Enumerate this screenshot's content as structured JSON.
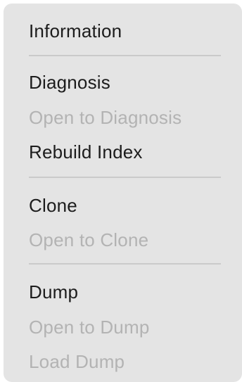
{
  "menu": {
    "items": [
      {
        "label": "Information",
        "enabled": true
      },
      {
        "label": "Diagnosis",
        "enabled": true
      },
      {
        "label": "Open to Diagnosis",
        "enabled": false
      },
      {
        "label": "Rebuild Index",
        "enabled": true
      },
      {
        "label": "Clone",
        "enabled": true
      },
      {
        "label": "Open to Clone",
        "enabled": false
      },
      {
        "label": "Dump",
        "enabled": true
      },
      {
        "label": "Open to Dump",
        "enabled": false
      },
      {
        "label": "Load Dump",
        "enabled": false
      }
    ]
  }
}
